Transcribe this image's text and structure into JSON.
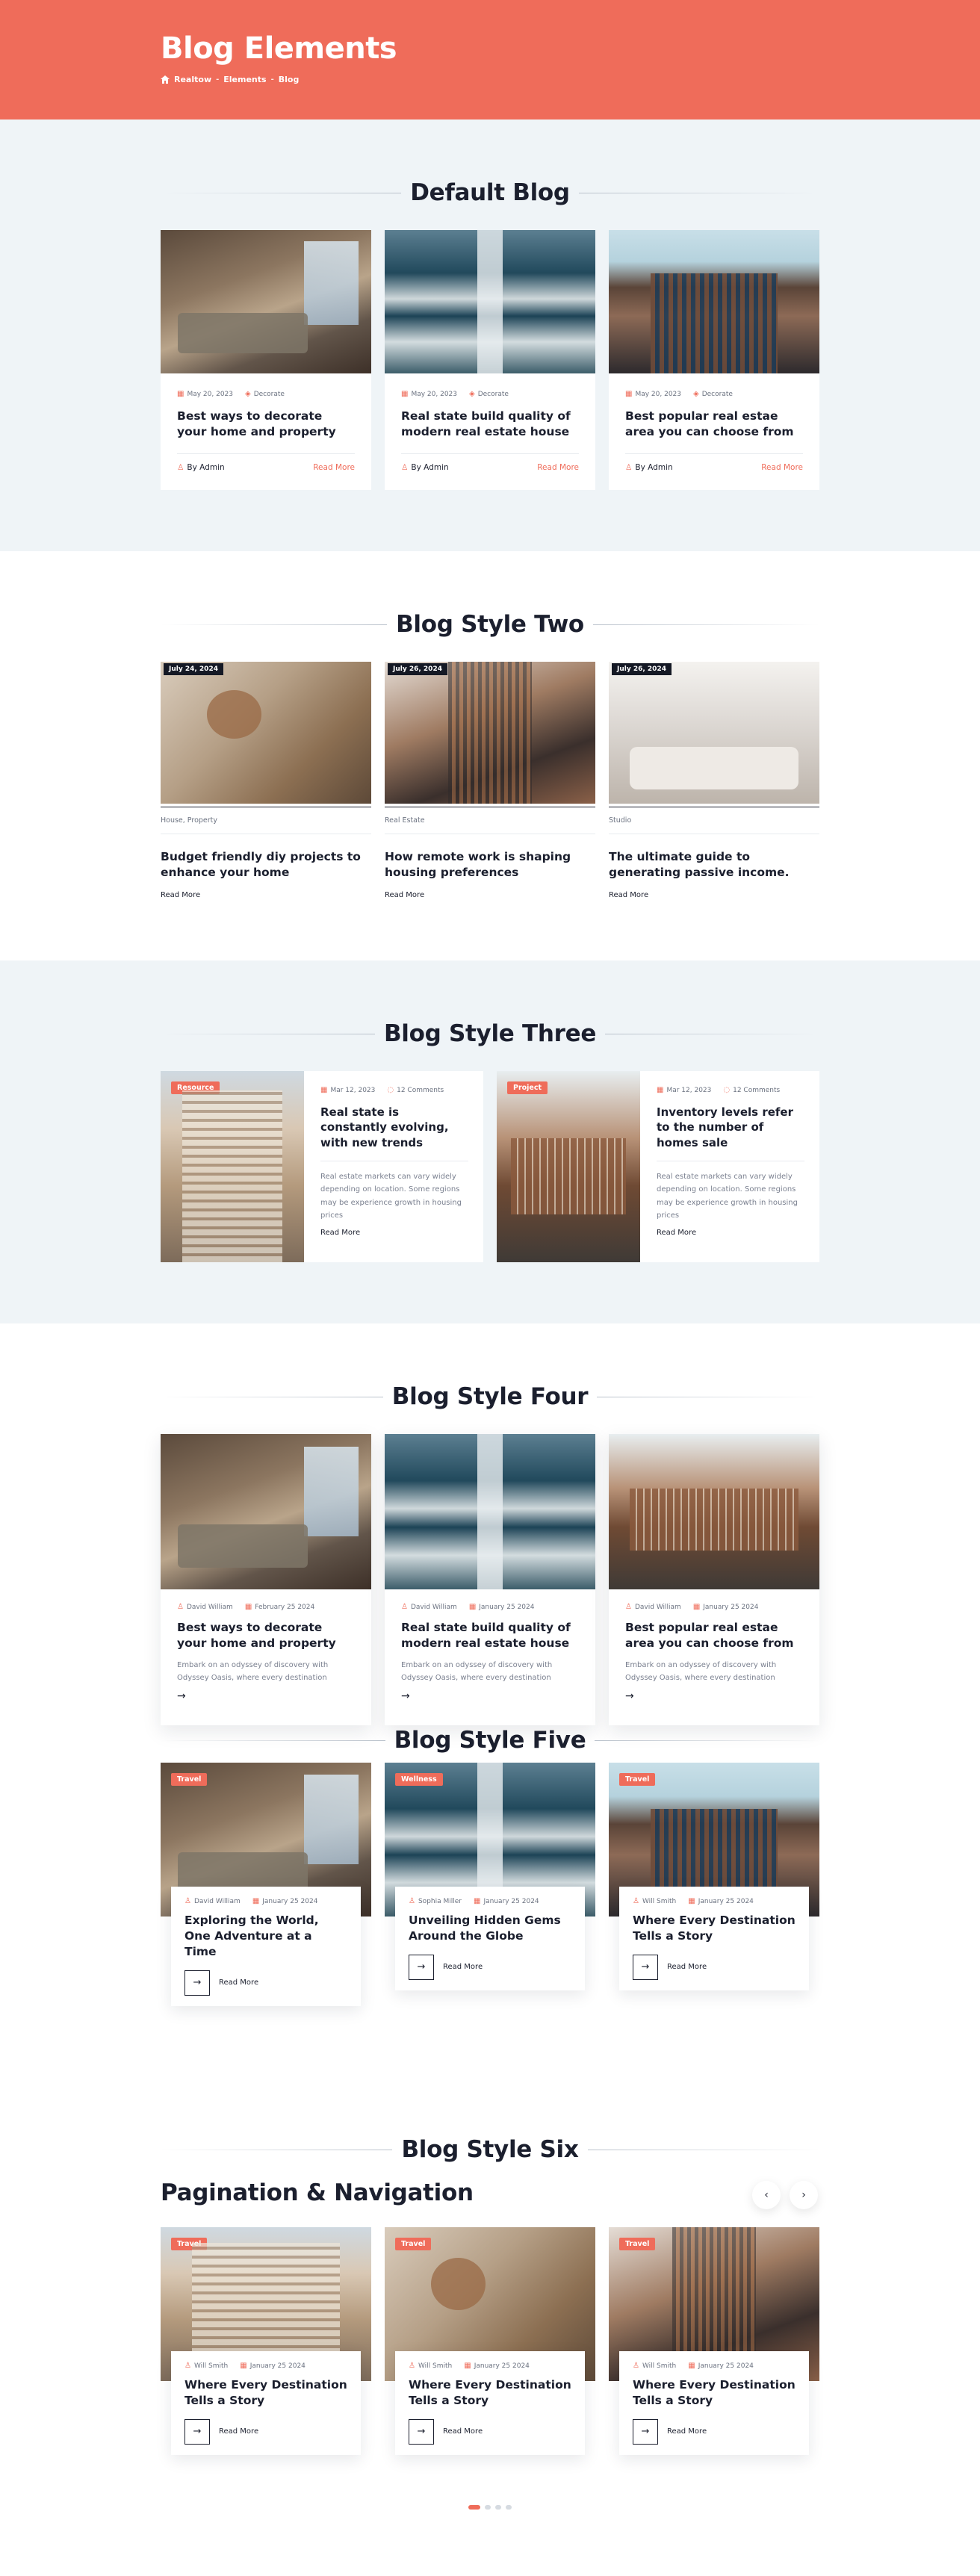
{
  "hero": {
    "title": "Blog Elements",
    "crumbs": [
      "Realtow",
      "Elements",
      "Blog"
    ],
    "separator": "-"
  },
  "colors": {
    "accent": "#ef6c5a",
    "dark": "#151925",
    "light_bg": "#eff4f7"
  },
  "s1": {
    "title": "Default Blog",
    "cards": [
      {
        "date": "May 20, 2023",
        "category": "Decorate",
        "title": "Best ways to decorate your home and property",
        "author": "By Admin",
        "read": "Read More"
      },
      {
        "date": "May 20, 2023",
        "category": "Decorate",
        "title": "Real state build quality of modern real estate house",
        "author": "By Admin",
        "read": "Read More"
      },
      {
        "date": "May 20, 2023",
        "category": "Decorate",
        "title": "Best popular real estae area you can choose from",
        "author": "By Admin",
        "read": "Read More"
      }
    ]
  },
  "s2": {
    "title": "Blog Style Two",
    "cards": [
      {
        "date": "July 24, 2024",
        "category": "House, Property",
        "title": "Budget friendly diy projects to enhance your home",
        "read": "Read More"
      },
      {
        "date": "July 26, 2024",
        "category": "Real Estate",
        "title": "How remote work is shaping housing preferences",
        "read": "Read More"
      },
      {
        "date": "July 26, 2024",
        "category": "Studio",
        "title": "The ultimate guide to generating passive income.",
        "read": "Read More"
      }
    ]
  },
  "s3": {
    "title": "Blog Style Three",
    "cards": [
      {
        "badge": "Resource",
        "date": "Mar 12, 2023",
        "comments": "12 Comments",
        "title": "Real state is constantly evolving, with new trends",
        "excerpt": "Real estate markets can vary widely depending on location. Some regions may be experience growth in housing prices",
        "read": "Read More"
      },
      {
        "badge": "Project",
        "date": "Mar 12, 2023",
        "comments": "12 Comments",
        "title": "Inventory levels refer to the number of homes sale",
        "excerpt": "Real estate markets can vary widely depending on location. Some regions may be experience growth in housing prices",
        "read": "Read More"
      }
    ]
  },
  "s4": {
    "title": "Blog Style Four",
    "cards": [
      {
        "author": "David William",
        "date": "February 25 2024",
        "title": "Best ways to decorate your home and property",
        "excerpt": "Embark on an odyssey of discovery with Odyssey Oasis, where every destination"
      },
      {
        "author": "David William",
        "date": "January 25 2024",
        "title": "Real state build quality of modern real estate house",
        "excerpt": "Embark on an odyssey of discovery with Odyssey Oasis, where every destination"
      },
      {
        "author": "David William",
        "date": "January 25 2024",
        "title": "Best popular real estae area you can choose from",
        "excerpt": "Embark on an odyssey of discovery with Odyssey Oasis, where every destination"
      }
    ]
  },
  "s5": {
    "title": "Blog Style Five",
    "cards": [
      {
        "badge": "Travel",
        "author": "David William",
        "date": "January 25 2024",
        "title": "Exploring the World, One Adventure at a Time",
        "read": "Read More"
      },
      {
        "badge": "Wellness",
        "author": "Sophia Miller",
        "date": "January 25 2024",
        "title": "Unveiling Hidden Gems Around the Globe",
        "read": "Read More"
      },
      {
        "badge": "Travel",
        "author": "Will Smith",
        "date": "January 25 2024",
        "title": "Where Every Destination Tells a Story",
        "read": "Read More"
      }
    ]
  },
  "s6": {
    "title": "Blog Style Six",
    "subtitle": "Pagination & Navigation",
    "prev": "‹",
    "next": "›",
    "cards": [
      {
        "badge": "Travel",
        "author": "Will Smith",
        "date": "January 25 2024",
        "title": "Where Every Destination Tells a Story",
        "read": "Read More"
      },
      {
        "badge": "Travel",
        "author": "Will Smith",
        "date": "January 25 2024",
        "title": "Where Every Destination Tells a Story",
        "read": "Read More"
      },
      {
        "badge": "Travel",
        "author": "Will Smith",
        "date": "January 25 2024",
        "title": "Where Every Destination Tells a Story",
        "read": "Read More"
      }
    ],
    "pages": 4,
    "active_page": 1
  },
  "icons": {
    "calendar": "calendar-icon",
    "tag": "tag-icon",
    "user": "user-icon",
    "comment": "comment-icon",
    "arrow": "arrow-right-icon",
    "home": "home-icon"
  }
}
